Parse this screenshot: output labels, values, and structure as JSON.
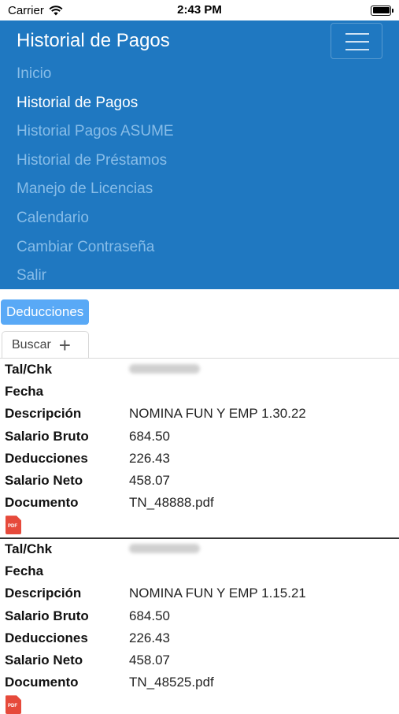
{
  "status": {
    "carrier": "Carrier",
    "time": "2:43 PM"
  },
  "navbar": {
    "brand": "Historial de Pagos",
    "items": [
      {
        "label": "Inicio",
        "active": false
      },
      {
        "label": "Historial de Pagos",
        "active": true
      },
      {
        "label": "Historial Pagos ASUME",
        "active": false
      },
      {
        "label": "Historial de Préstamos",
        "active": false
      },
      {
        "label": "Manejo de Licencias",
        "active": false
      },
      {
        "label": "Calendario",
        "active": false
      },
      {
        "label": "Cambiar Contraseña",
        "active": false
      },
      {
        "label": "Salir",
        "active": false
      }
    ]
  },
  "content": {
    "tab_label": "Deducciones",
    "search_label": "Buscar",
    "labels": {
      "talchk": "Tal/Chk",
      "fecha": "Fecha",
      "descripcion": "Descripción",
      "bruto": "Salario Bruto",
      "deducciones": "Deducciones",
      "neto": "Salario Neto",
      "documento": "Documento"
    },
    "records": [
      {
        "fecha": "",
        "descripcion": "NOMINA FUN Y EMP 1.30.22",
        "bruto": "684.50",
        "deducciones": "226.43",
        "neto": "458.07",
        "documento": "TN_48888.pdf",
        "pdf_icon_text": "PDF"
      },
      {
        "fecha": "",
        "descripcion": "NOMINA FUN Y EMP 1.15.21",
        "bruto": "684.50",
        "deducciones": "226.43",
        "neto": "458.07",
        "documento": "TN_48525.pdf",
        "pdf_icon_text": "PDF"
      }
    ]
  },
  "colors": {
    "navbar": "#1f78c1",
    "tab": "#59a9f6",
    "pdf": "#e64a3b"
  }
}
